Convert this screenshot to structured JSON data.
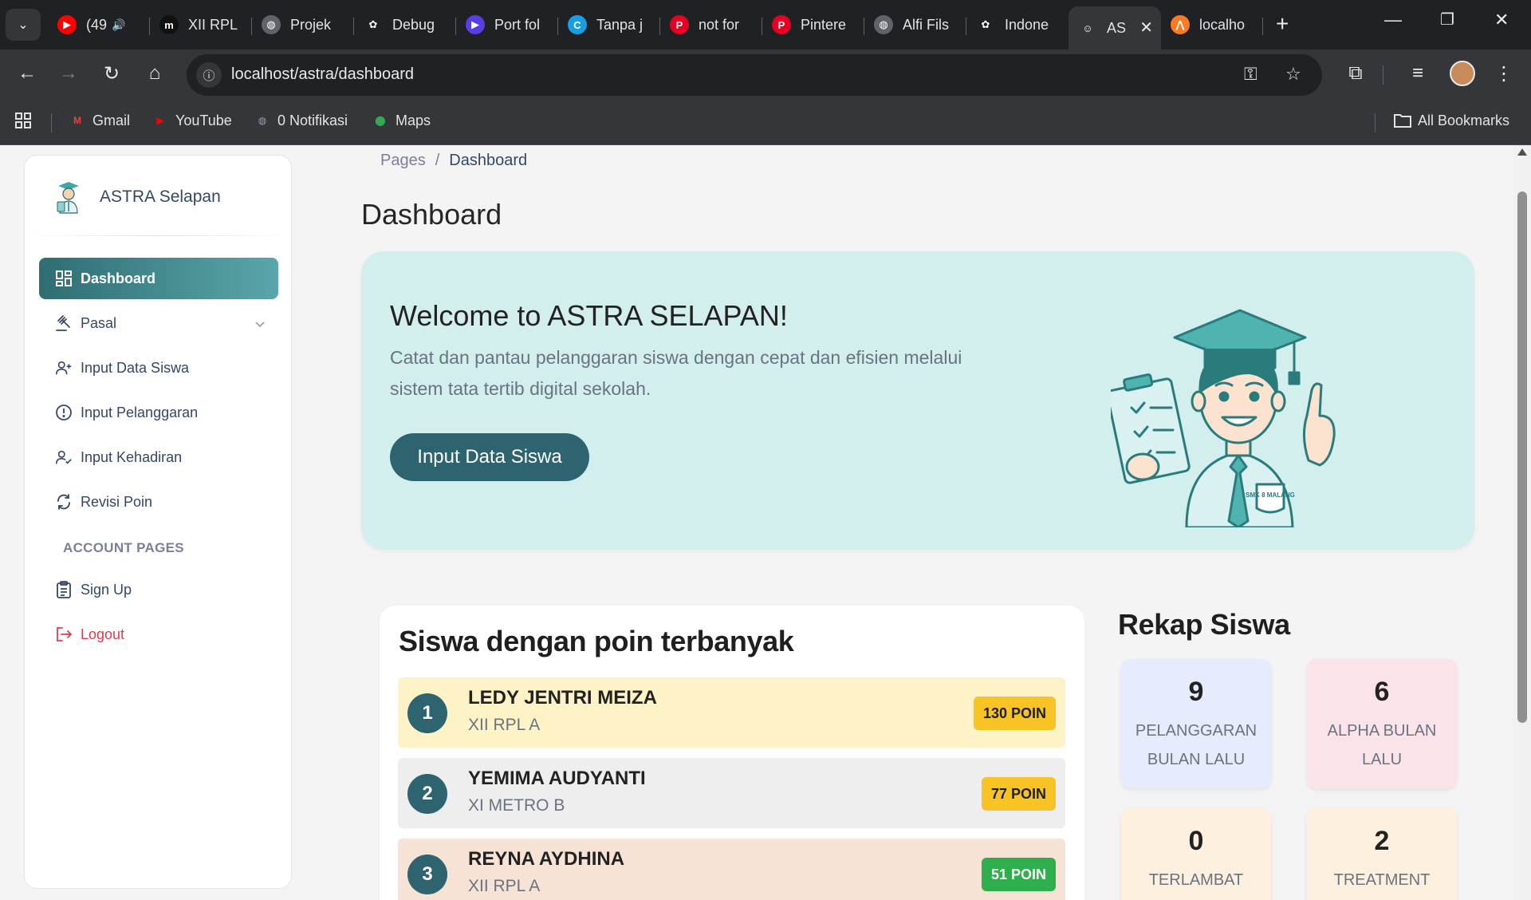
{
  "browser": {
    "tabs": [
      {
        "title": "(49",
        "icon": "youtube-icon",
        "color": "#ff0000",
        "glyph": "▶",
        "audio": true
      },
      {
        "title": "XII RPL",
        "icon": "m-app-icon",
        "color": "#111111",
        "glyph": "m"
      },
      {
        "title": "Projek",
        "icon": "globe-icon",
        "color": "#5f6368",
        "glyph": "◍"
      },
      {
        "title": "Debug",
        "icon": "openai-icon",
        "color": "#202124",
        "glyph": "✿"
      },
      {
        "title": "Port fol",
        "icon": "video-app-icon",
        "color": "#5b3de6",
        "glyph": "▶"
      },
      {
        "title": "Tanpa j",
        "icon": "canva-icon",
        "color": "#1a9ee2",
        "glyph": "C"
      },
      {
        "title": "not for",
        "icon": "pinterest-icon",
        "color": "#e60023",
        "glyph": "P"
      },
      {
        "title": "Pintere",
        "icon": "pinterest-icon",
        "color": "#e60023",
        "glyph": "P"
      },
      {
        "title": "Alfi Fils",
        "icon": "globe-icon",
        "color": "#5f6368",
        "glyph": "◍"
      },
      {
        "title": "Indone",
        "icon": "openai-icon",
        "color": "#202124",
        "glyph": "✿"
      },
      {
        "title": "AS",
        "icon": "astra-favicon-icon",
        "color": "#35363a",
        "glyph": "☺",
        "active": true
      },
      {
        "title": "localho",
        "icon": "xampp-icon",
        "color": "#fb7a24",
        "glyph": "⋀"
      }
    ],
    "url": "localhost/astra/dashboard",
    "bookmarks": [
      {
        "label": "Gmail",
        "icon": "gmail-icon",
        "color": "#ea4335",
        "glyph": "M"
      },
      {
        "label": "YouTube",
        "icon": "youtube-icon",
        "color": "#ff0000",
        "glyph": "▶"
      },
      {
        "label": "0 Notifikasi",
        "icon": "globe-icon",
        "color": "#9aa0a6",
        "glyph": "◍"
      },
      {
        "label": "Maps",
        "icon": "maps-pin-icon",
        "color": "#34a853",
        "glyph": "⬤"
      }
    ],
    "all_bookmarks": "All Bookmarks"
  },
  "sidebar": {
    "brand": "ASTRA Selapan",
    "items": [
      {
        "label": "Dashboard",
        "icon": "dashboard-grid-icon",
        "active": true
      },
      {
        "label": "Pasal",
        "icon": "gavel-icon",
        "dropdown": true
      },
      {
        "label": "Input Data Siswa",
        "icon": "user-add-icon"
      },
      {
        "label": "Input Pelanggaran",
        "icon": "alert-circle-icon"
      },
      {
        "label": "Input Kehadiran",
        "icon": "user-check-icon"
      },
      {
        "label": "Revisi Poin",
        "icon": "refresh-icon"
      }
    ],
    "section_title": "ACCOUNT PAGES",
    "account_items": [
      {
        "label": "Sign Up",
        "icon": "clipboard-icon"
      },
      {
        "label": "Logout",
        "icon": "logout-icon",
        "danger": true
      }
    ]
  },
  "breadcrumb": {
    "parent": "Pages",
    "separator": "/",
    "current": "Dashboard"
  },
  "page_title": "Dashboard",
  "hero": {
    "title": "Welcome to ASTRA SELAPAN!",
    "subtitle": "Catat dan pantau pelanggaran siswa dengan cepat dan efisien melalui sistem tata tertib digital sekolah.",
    "button": "Input Data Siswa",
    "illustration_badge": "SMK 8 MALANG"
  },
  "top_students": {
    "title": "Siswa dengan poin terbanyak",
    "rows": [
      {
        "rank": "1",
        "name": "LEDY JENTRI MEIZA",
        "class": "XII RPL A",
        "points": "130 POIN",
        "row_bg": "#fdf3c7",
        "badge_bg": "#f7c325",
        "badge_fg": "#1f1f1f"
      },
      {
        "rank": "2",
        "name": "YEMIMA AUDYANTI",
        "class": "XI METRO B",
        "points": "77 POIN",
        "row_bg": "#eeeeee",
        "badge_bg": "#f7c325",
        "badge_fg": "#1f1f1f"
      },
      {
        "rank": "3",
        "name": "REYNA AYDHINA",
        "class": "XII RPL A",
        "points": "51 POIN",
        "row_bg": "#f6e3d6",
        "badge_bg": "#2fae4e",
        "badge_fg": "#ffffff"
      }
    ]
  },
  "rekap": {
    "title": "Rekap Siswa",
    "stats": [
      {
        "value": "9",
        "label": "PELANGGARAN BULAN LALU",
        "bg": "#e6ecfb"
      },
      {
        "value": "6",
        "label": "ALPHA BULAN LALU",
        "bg": "#fbe3ea"
      },
      {
        "value": "0",
        "label": "TERLAMBAT",
        "bg": "#fdf0df"
      },
      {
        "value": "2",
        "label": "TREATMENT",
        "bg": "#fdf0df"
      }
    ]
  }
}
